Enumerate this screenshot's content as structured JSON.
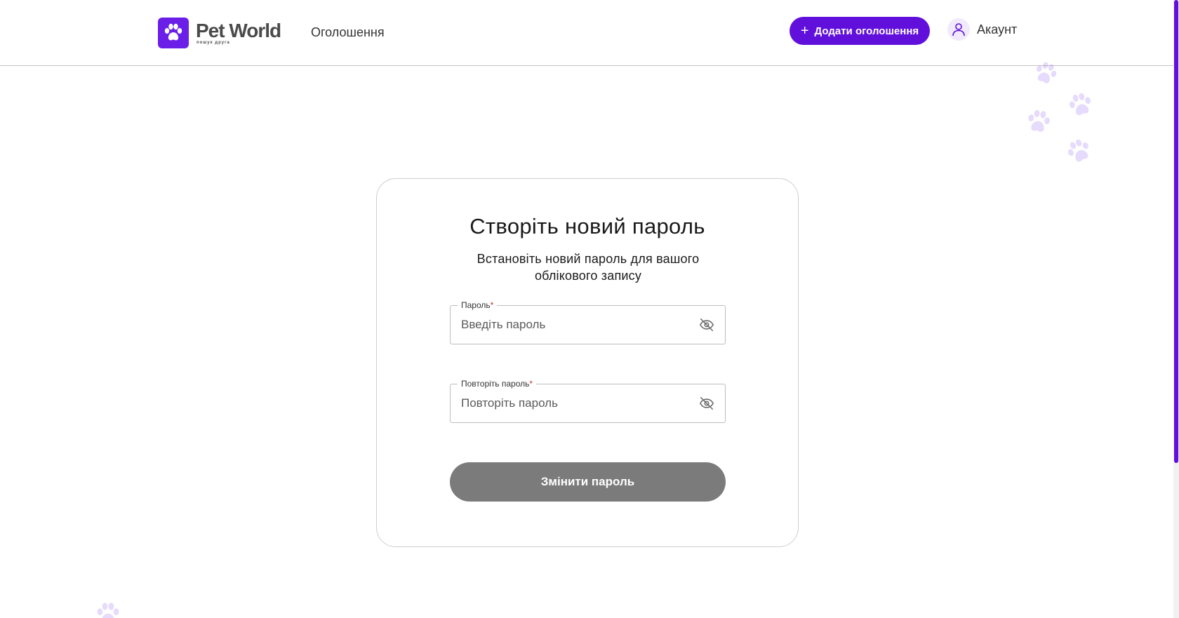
{
  "header": {
    "logo_title": "Pet World",
    "logo_subtitle": "пошук друга",
    "nav_listings": "Оголошення",
    "add_listing_button": "Додати оголошення",
    "account_label": "Акаунт"
  },
  "form": {
    "title": "Створіть новий пароль",
    "subtitle": "Встановіть новий пароль для вашого облікового запису",
    "password": {
      "label": "Пароль",
      "required_mark": "*",
      "placeholder": "Введіть пароль",
      "value": ""
    },
    "repeat_password": {
      "label": "Повторіть пароль",
      "required_mark": "*",
      "placeholder": "Повторіть пароль",
      "value": ""
    },
    "submit_button": "Змінити пароль"
  },
  "icons": {
    "logo": "paw-icon",
    "add": "plus-icon",
    "account": "user-icon",
    "password_toggle": "eye-off-icon",
    "decoration": "paw-print-icon"
  },
  "colors": {
    "brand": "#6110dc",
    "button_disabled": "#7b7b7b",
    "required": "#c0392b"
  }
}
